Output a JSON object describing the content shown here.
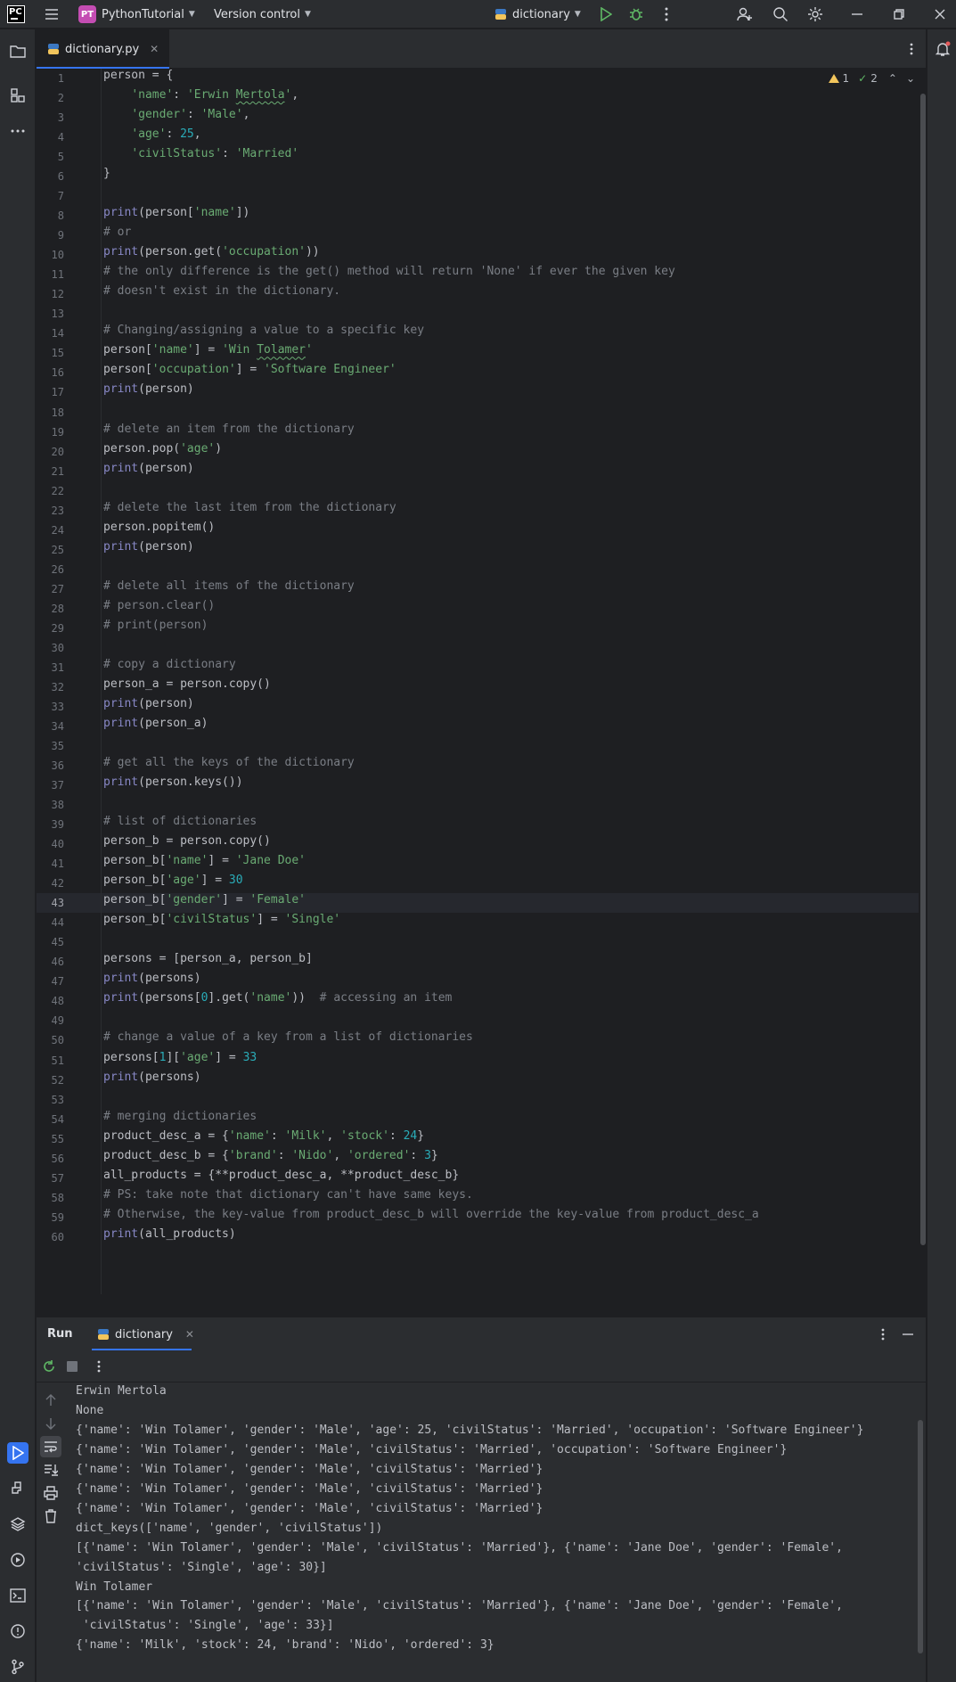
{
  "titlebar": {
    "ide_logo": "PC",
    "project_badge": "PT",
    "project_name": "PythonTutorial",
    "vcs_label": "Version control",
    "run_config": "dictionary"
  },
  "editor_tab": {
    "filename": "dictionary.py"
  },
  "inspections": {
    "warnings": "1",
    "weak_warnings": "2"
  },
  "current_line": "43",
  "line_numbers": [
    "1",
    "2",
    "3",
    "4",
    "5",
    "6",
    "7",
    "8",
    "9",
    "10",
    "11",
    "12",
    "13",
    "14",
    "15",
    "16",
    "17",
    "18",
    "19",
    "20",
    "21",
    "22",
    "23",
    "24",
    "25",
    "26",
    "27",
    "28",
    "29",
    "30",
    "31",
    "32",
    "33",
    "34",
    "35",
    "36",
    "37",
    "38",
    "39",
    "40",
    "41",
    "42",
    "43",
    "44",
    "45",
    "46",
    "47",
    "48",
    "49",
    "50",
    "51",
    "52",
    "53",
    "54",
    "55",
    "56",
    "57",
    "58",
    "59",
    "60"
  ],
  "code": [
    [
      [
        "p",
        "person = {"
      ]
    ],
    [
      [
        "p",
        "    "
      ],
      [
        "s",
        "'name'"
      ],
      [
        "p",
        ": "
      ],
      [
        "s",
        "'Erwin "
      ],
      [
        "sq",
        "Mertola"
      ],
      [
        "s",
        "'"
      ],
      [
        "p",
        ","
      ]
    ],
    [
      [
        "p",
        "    "
      ],
      [
        "s",
        "'gender'"
      ],
      [
        "p",
        ": "
      ],
      [
        "s",
        "'Male'"
      ],
      [
        "p",
        ","
      ]
    ],
    [
      [
        "p",
        "    "
      ],
      [
        "s",
        "'age'"
      ],
      [
        "p",
        ": "
      ],
      [
        "n",
        "25"
      ],
      [
        "p",
        ","
      ]
    ],
    [
      [
        "p",
        "    "
      ],
      [
        "s",
        "'civilStatus'"
      ],
      [
        "p",
        ": "
      ],
      [
        "s",
        "'Married'"
      ]
    ],
    [
      [
        "p",
        "}"
      ]
    ],
    [],
    [
      [
        "b",
        "print"
      ],
      [
        "p",
        "(person["
      ],
      [
        "s",
        "'name'"
      ],
      [
        "p",
        "])"
      ]
    ],
    [
      [
        "c",
        "# or"
      ]
    ],
    [
      [
        "b",
        "print"
      ],
      [
        "p",
        "(person.get("
      ],
      [
        "s",
        "'occupation'"
      ],
      [
        "p",
        "))"
      ]
    ],
    [
      [
        "c",
        "# the only difference is the get() method will return 'None' if ever the given key"
      ]
    ],
    [
      [
        "c",
        "# doesn't exist in the dictionary."
      ]
    ],
    [],
    [
      [
        "c",
        "# Changing/assigning a value to a specific key"
      ]
    ],
    [
      [
        "p",
        "person["
      ],
      [
        "s",
        "'name'"
      ],
      [
        "p",
        "] = "
      ],
      [
        "s",
        "'Win "
      ],
      [
        "sq",
        "Tolamer"
      ],
      [
        "s",
        "'"
      ]
    ],
    [
      [
        "p",
        "person["
      ],
      [
        "s",
        "'occupation'"
      ],
      [
        "p",
        "] = "
      ],
      [
        "s",
        "'Software Engineer'"
      ]
    ],
    [
      [
        "b",
        "print"
      ],
      [
        "p",
        "(person)"
      ]
    ],
    [],
    [
      [
        "c",
        "# delete an item from the dictionary"
      ]
    ],
    [
      [
        "p",
        "person.pop("
      ],
      [
        "s",
        "'age'"
      ],
      [
        "p",
        ")"
      ]
    ],
    [
      [
        "b",
        "print"
      ],
      [
        "p",
        "(person)"
      ]
    ],
    [],
    [
      [
        "c",
        "# delete the last item from the dictionary"
      ]
    ],
    [
      [
        "p",
        "person.popitem()"
      ]
    ],
    [
      [
        "b",
        "print"
      ],
      [
        "p",
        "(person)"
      ]
    ],
    [],
    [
      [
        "c",
        "# delete all items of the dictionary"
      ]
    ],
    [
      [
        "c",
        "# person.clear()"
      ]
    ],
    [
      [
        "c",
        "# print(person)"
      ]
    ],
    [],
    [
      [
        "c",
        "# copy a dictionary"
      ]
    ],
    [
      [
        "p",
        "person_a = person.copy()"
      ]
    ],
    [
      [
        "b",
        "print"
      ],
      [
        "p",
        "(person)"
      ]
    ],
    [
      [
        "b",
        "print"
      ],
      [
        "p",
        "(person_a)"
      ]
    ],
    [],
    [
      [
        "c",
        "# get all the keys of the dictionary"
      ]
    ],
    [
      [
        "b",
        "print"
      ],
      [
        "p",
        "(person.keys())"
      ]
    ],
    [],
    [
      [
        "c",
        "# list of dictionaries"
      ]
    ],
    [
      [
        "p",
        "person_b = person.copy()"
      ]
    ],
    [
      [
        "p",
        "person_b["
      ],
      [
        "s",
        "'name'"
      ],
      [
        "p",
        "] = "
      ],
      [
        "s",
        "'Jane Doe'"
      ]
    ],
    [
      [
        "p",
        "person_b["
      ],
      [
        "s",
        "'age'"
      ],
      [
        "p",
        "] = "
      ],
      [
        "n",
        "30"
      ]
    ],
    [
      [
        "p",
        "person_b["
      ],
      [
        "s",
        "'gender'"
      ],
      [
        "p",
        "] = "
      ],
      [
        "s",
        "'Female'"
      ]
    ],
    [
      [
        "p",
        "person_b["
      ],
      [
        "s",
        "'civilStatus'"
      ],
      [
        "p",
        "] = "
      ],
      [
        "s",
        "'Single'"
      ]
    ],
    [],
    [
      [
        "p",
        "persons = [person_a, person_b]"
      ]
    ],
    [
      [
        "b",
        "print"
      ],
      [
        "p",
        "(persons)"
      ]
    ],
    [
      [
        "b",
        "print"
      ],
      [
        "p",
        "(persons["
      ],
      [
        "n",
        "0"
      ],
      [
        "p",
        "].get("
      ],
      [
        "s",
        "'name'"
      ],
      [
        "p",
        "))  "
      ],
      [
        "c",
        "# accessing an item"
      ]
    ],
    [],
    [
      [
        "c",
        "# change a value of a key from a list of dictionaries"
      ]
    ],
    [
      [
        "p",
        "persons["
      ],
      [
        "n",
        "1"
      ],
      [
        "p",
        "]["
      ],
      [
        "s",
        "'age'"
      ],
      [
        "p",
        "] = "
      ],
      [
        "n",
        "33"
      ]
    ],
    [
      [
        "b",
        "print"
      ],
      [
        "p",
        "(persons)"
      ]
    ],
    [],
    [
      [
        "c",
        "# merging dictionaries"
      ]
    ],
    [
      [
        "p",
        "product_desc_a = {"
      ],
      [
        "s",
        "'name'"
      ],
      [
        "p",
        ": "
      ],
      [
        "s",
        "'Milk'"
      ],
      [
        "p",
        ", "
      ],
      [
        "s",
        "'stock'"
      ],
      [
        "p",
        ": "
      ],
      [
        "n",
        "24"
      ],
      [
        "p",
        "}"
      ]
    ],
    [
      [
        "p",
        "product_desc_b = {"
      ],
      [
        "s",
        "'brand'"
      ],
      [
        "p",
        ": "
      ],
      [
        "s",
        "'Nido'"
      ],
      [
        "p",
        ", "
      ],
      [
        "s",
        "'ordered'"
      ],
      [
        "p",
        ": "
      ],
      [
        "n",
        "3"
      ],
      [
        "p",
        "}"
      ]
    ],
    [
      [
        "p",
        "all_products = {**product_desc_a, **product_desc_b}"
      ]
    ],
    [
      [
        "c",
        "# PS: take note that dictionary can't have same keys."
      ]
    ],
    [
      [
        "c",
        "# Otherwise, the key-value from product_desc_b will override the key-value from product_desc_a"
      ]
    ],
    [
      [
        "b",
        "print"
      ],
      [
        "p",
        "(all_products)"
      ]
    ]
  ],
  "run_panel": {
    "title": "Run",
    "tab_label": "dictionary",
    "output": [
      "Erwin Mertola",
      "None",
      "{'name': 'Win Tolamer', 'gender': 'Male', 'age': 25, 'civilStatus': 'Married', 'occupation': 'Software Engineer'}",
      "{'name': 'Win Tolamer', 'gender': 'Male', 'civilStatus': 'Married', 'occupation': 'Software Engineer'}",
      "{'name': 'Win Tolamer', 'gender': 'Male', 'civilStatus': 'Married'}",
      "{'name': 'Win Tolamer', 'gender': 'Male', 'civilStatus': 'Married'}",
      "{'name': 'Win Tolamer', 'gender': 'Male', 'civilStatus': 'Married'}",
      "dict_keys(['name', 'gender', 'civilStatus'])",
      "[{'name': 'Win Tolamer', 'gender': 'Male', 'civilStatus': 'Married'}, {'name': 'Jane Doe', 'gender': 'Female', ",
      "'civilStatus': 'Single', 'age': 30}]",
      "Win Tolamer",
      "[{'name': 'Win Tolamer', 'gender': 'Male', 'civilStatus': 'Married'}, {'name': 'Jane Doe', 'gender': 'Female',",
      " 'civilStatus': 'Single', 'age': 33}]",
      "{'name': 'Milk', 'stock': 24, 'brand': 'Nido', 'ordered': 3}"
    ]
  },
  "colors": {
    "accent": "#3574f0",
    "string": "#6aab73",
    "number": "#2aacb8",
    "builtin": "#8888c6",
    "comment": "#7a7e85",
    "run_green": "#5fb865",
    "debug_green": "#5fb865",
    "warning": "#f2c55c"
  }
}
